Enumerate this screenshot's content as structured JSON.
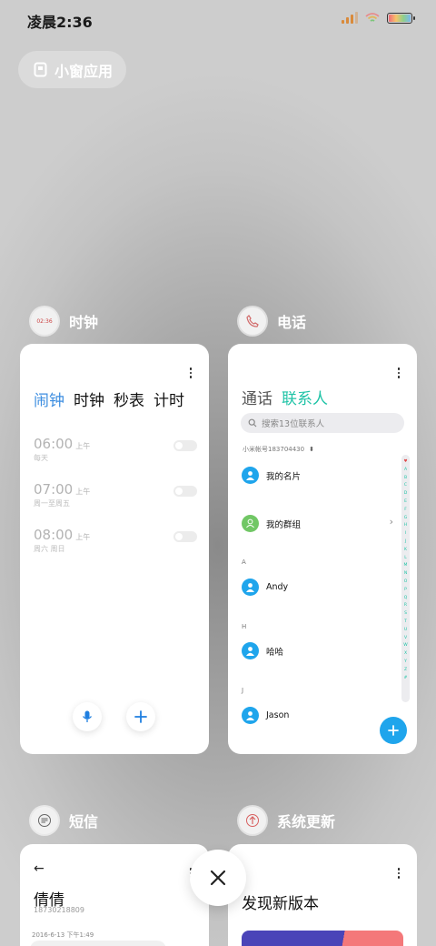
{
  "status_bar": {
    "time": "凌晨2:36"
  },
  "floating_window_button": {
    "label": "小窗应用"
  },
  "apps": {
    "clock": {
      "name": "时钟",
      "icon_time": "02:36",
      "tabs": [
        "闹钟",
        "时钟",
        "秒表",
        "计时"
      ],
      "alarms": [
        {
          "time": "06:00",
          "ampm": "上午",
          "repeat": "每天"
        },
        {
          "time": "07:00",
          "ampm": "上午",
          "repeat": "周一至周五"
        },
        {
          "time": "08:00",
          "ampm": "上午",
          "repeat": "周六 周日"
        }
      ]
    },
    "phone": {
      "name": "电话",
      "tabs": [
        "通话",
        "联系人"
      ],
      "search_placeholder": "搜索13位联系人",
      "account": "小米帐号183704430",
      "contacts": [
        {
          "name": "我的名片"
        },
        {
          "name": "我的群组"
        },
        {
          "section": "A",
          "name": "Andy"
        },
        {
          "section": "H",
          "name": "哈哈"
        },
        {
          "section": "J",
          "name": "Jason"
        }
      ],
      "index_letters": [
        "A",
        "B",
        "C",
        "D",
        "E",
        "F",
        "G",
        "H",
        "I",
        "J",
        "K",
        "L",
        "M",
        "N",
        "O",
        "P",
        "Q",
        "R",
        "S",
        "T",
        "U",
        "V",
        "W",
        "X",
        "Y",
        "Z",
        "#"
      ]
    },
    "sms": {
      "name": "短信",
      "contact_name": "倩倩",
      "contact_phone": "18730218809",
      "date": "2016-6-13 下午1:49"
    },
    "update": {
      "name": "系统更新",
      "title": "发现新版本"
    }
  },
  "colors": {
    "clock_accent": "#3d8ee0",
    "contacts_accent": "#1fc3a6",
    "contact_avatar": "#1fa5ec",
    "group_avatar": "#71c765"
  }
}
